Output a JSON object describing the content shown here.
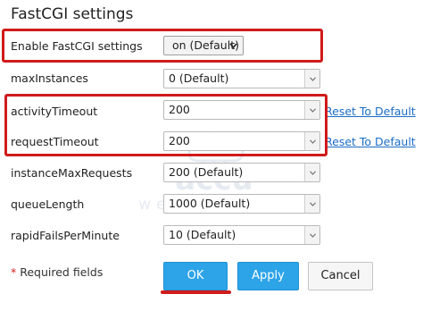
{
  "title": "FastCGI settings",
  "rows": [
    {
      "label": "Enable FastCGI settings",
      "value": "on (Default)"
    },
    {
      "label": "maxInstances",
      "value": "0 (Default)"
    },
    {
      "label": "activityTimeout",
      "value": "200",
      "reset": "Reset To Default"
    },
    {
      "label": "requestTimeout",
      "value": "200",
      "reset": "Reset To Default"
    },
    {
      "label": "instanceMaxRequests",
      "value": "200 (Default)"
    },
    {
      "label": "queueLength",
      "value": "1000 (Default)"
    },
    {
      "label": "rapidFailsPerMinute",
      "value": "10 (Default)"
    }
  ],
  "required": {
    "star": "*",
    "text": "Required fields"
  },
  "buttons": {
    "ok": "OK",
    "apply": "Apply",
    "cancel": "Cancel"
  },
  "watermark": {
    "brand": "accu",
    "tagline": "web hosting"
  },
  "colors": {
    "highlight": "#d01b1b",
    "primary": "#2da4e8",
    "link": "#1a6cc4"
  }
}
